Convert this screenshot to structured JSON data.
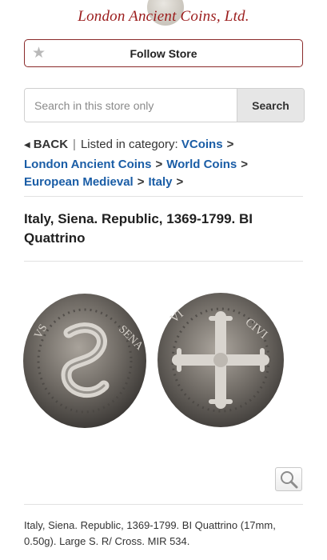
{
  "store": {
    "logo_text": "London Ancient Coins, Ltd.",
    "follow_label": "Follow Store"
  },
  "search": {
    "placeholder": "Search in this store only",
    "button_label": "Search"
  },
  "breadcrumb": {
    "back_label": "BACK",
    "separator": "|",
    "category_prefix": "Listed in category:",
    "items": [
      "VCoins",
      "London Ancient Coins",
      "World Coins",
      "European Medieval",
      "Italy"
    ],
    "arrow": ">"
  },
  "item": {
    "title": "Italy, Siena. Republic, 1369-1799. BI Quattrino",
    "description": "Italy, Siena. Republic, 1369-1799. BI Quattrino (17mm, 0.50g). Large S. R/ Cross. MIR 534."
  },
  "colors": {
    "brand": "#9b1c1c",
    "link": "#1a5da6",
    "follow_border": "#8a2a2a"
  },
  "icons": [
    "star-icon",
    "back-triangle-icon",
    "zoom-magnifier-icon"
  ]
}
